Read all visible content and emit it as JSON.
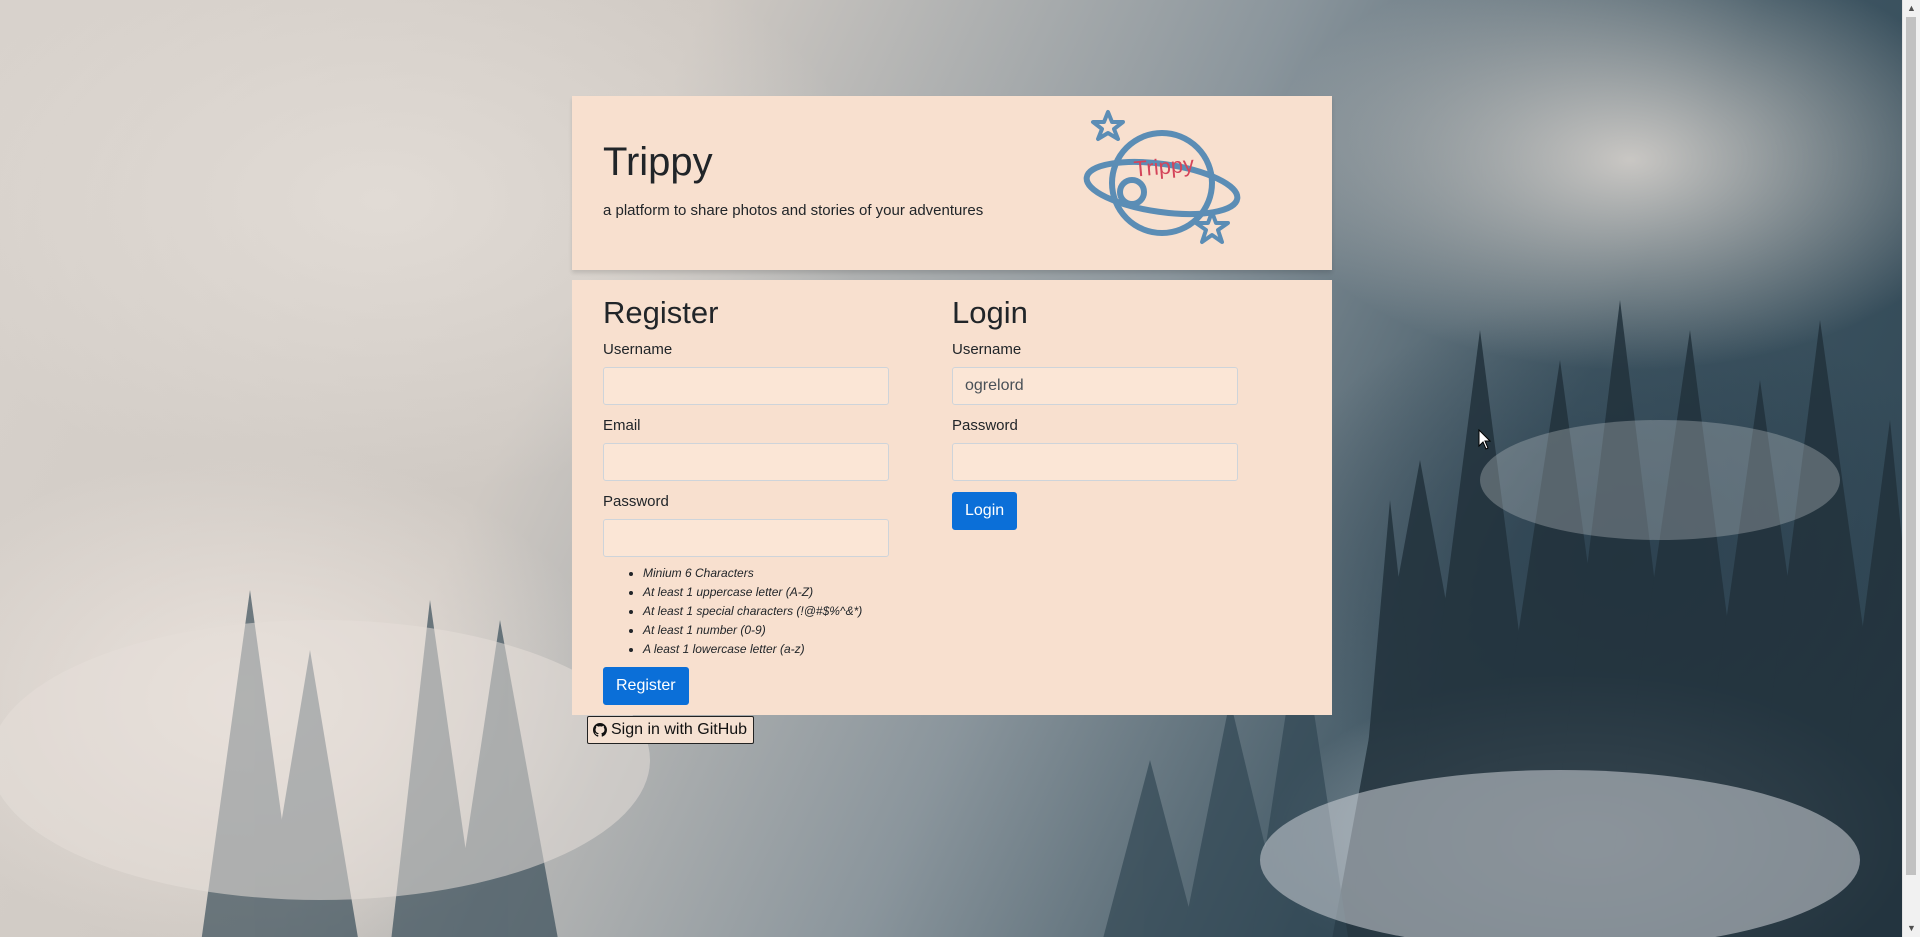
{
  "header": {
    "title": "Trippy",
    "tagline": "a platform to share photos and stories of your adventures",
    "logo_text": "Trippy"
  },
  "register": {
    "heading": "Register",
    "username_label": "Username",
    "username_value": "",
    "email_label": "Email",
    "email_value": "",
    "password_label": "Password",
    "password_value": "",
    "password_rules": [
      "Minium 6 Characters",
      "At least 1 uppercase letter (A-Z)",
      "At least 1 special characters (!@#$%^&*)",
      "At least 1 number (0-9)",
      "A least 1 lowercase letter (a-z)"
    ],
    "button_label": "Register"
  },
  "login": {
    "heading": "Login",
    "username_label": "Username",
    "username_value": "ogrelord",
    "password_label": "Password",
    "password_value": "",
    "button_label": "Login"
  },
  "github_button_label": "Sign in with GitHub",
  "icons": {
    "logo": "trippy-planet-logo",
    "github": "github-icon",
    "cursor": "mouse-cursor-icon"
  },
  "colors": {
    "card_background": "#f8e0cf",
    "primary_button": "#0b6fd8",
    "logo_blue": "#5b8db5",
    "logo_text": "#d4445a"
  }
}
